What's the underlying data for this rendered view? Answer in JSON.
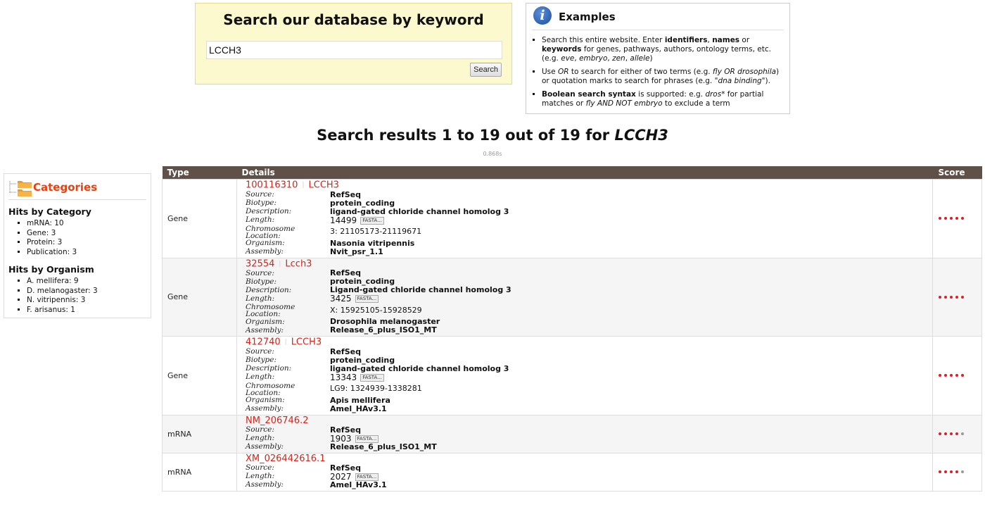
{
  "search": {
    "title": "Search our database by keyword",
    "query": "LCCH3",
    "button_label": "Search"
  },
  "examples": {
    "title": "Examples",
    "items": [
      [
        "Search this entire website. Enter ",
        "identifiers",
        ", ",
        "names",
        " or ",
        "keywords",
        " for genes, pathways, authors, ontology terms, etc. (e.g. ",
        "eve",
        ", ",
        "embryo",
        ", ",
        "zen",
        ", ",
        "allele",
        ")"
      ],
      [
        "Use ",
        "OR",
        " to search for either of two terms (e.g. ",
        "fly OR drosophila",
        ") or quotation marks to search for phrases (e.g. ",
        "\"dna binding\"",
        ")."
      ],
      [
        "Boolean search syntax",
        " is supported: e.g. ",
        "dros*",
        " for partial matches or ",
        "fly AND NOT embryo",
        " to exclude a term"
      ]
    ]
  },
  "results_header": {
    "prefix": "Search results 1 to 19 out of 19 for ",
    "keyword": "LCCH3",
    "timing": "0.868s"
  },
  "categories": {
    "title": "Categories",
    "by_category_heading": "Hits by Category",
    "by_category": [
      "mRNA: 10",
      "Gene: 3",
      "Protein: 3",
      "Publication: 3"
    ],
    "by_organism_heading": "Hits by Organism",
    "by_organism": [
      "A. mellifera: 9",
      "D. melanogaster: 3",
      "N. vitripennis: 3",
      "F. arisanus: 1"
    ]
  },
  "table": {
    "headers": {
      "type": "Type",
      "details": "Details",
      "score": "Score"
    },
    "fasta_label": "FASTA...",
    "rows": [
      {
        "type": "Gene",
        "id": "100116310",
        "symbol": "LCCH3",
        "fields": [
          {
            "label": "Source:",
            "value": "RefSeq"
          },
          {
            "label": "Biotype:",
            "value": "protein_coding"
          },
          {
            "label": "Description:",
            "value": "ligand-gated chloride channel homolog 3"
          },
          {
            "label": "Length:",
            "value": "14499",
            "fasta": true
          },
          {
            "label": "Chromosome Location:",
            "value": "3: 21105173-21119671",
            "plain": true
          },
          {
            "label": "Organism:",
            "value": "Nasonia vitripennis"
          },
          {
            "label": "Assembly:",
            "value": "Nvit_psr_1.1"
          }
        ],
        "score": 5
      },
      {
        "type": "Gene",
        "id": "32554",
        "symbol": "Lcch3",
        "fields": [
          {
            "label": "Source:",
            "value": "RefSeq"
          },
          {
            "label": "Biotype:",
            "value": "protein_coding"
          },
          {
            "label": "Description:",
            "value": "Ligand-gated chloride channel homolog 3"
          },
          {
            "label": "Length:",
            "value": "3425",
            "fasta": true
          },
          {
            "label": "Chromosome Location:",
            "value": "X: 15925105-15928529",
            "plain": true
          },
          {
            "label": "Organism:",
            "value": "Drosophila melanogaster"
          },
          {
            "label": "Assembly:",
            "value": "Release_6_plus_ISO1_MT"
          }
        ],
        "score": 5
      },
      {
        "type": "Gene",
        "id": "412740",
        "symbol": "LCCH3",
        "fields": [
          {
            "label": "Source:",
            "value": "RefSeq"
          },
          {
            "label": "Biotype:",
            "value": "protein_coding"
          },
          {
            "label": "Description:",
            "value": "ligand-gated chloride channel homolog 3"
          },
          {
            "label": "Length:",
            "value": "13343",
            "fasta": true
          },
          {
            "label": "Chromosome Location:",
            "value": "LG9: 1324939-1338281",
            "plain": true
          },
          {
            "label": "Organism:",
            "value": "Apis mellifera"
          },
          {
            "label": "Assembly:",
            "value": "Amel_HAv3.1"
          }
        ],
        "score": 5
      },
      {
        "type": "mRNA",
        "id": "NM_206746.2",
        "symbol": "",
        "fields": [
          {
            "label": "Source:",
            "value": "RefSeq"
          },
          {
            "label": "Length:",
            "value": "1903",
            "fasta": true
          },
          {
            "label": "Assembly:",
            "value": "Release_6_plus_ISO1_MT"
          }
        ],
        "score": 4
      },
      {
        "type": "mRNA",
        "id": "XM_026442616.1",
        "symbol": "",
        "fields": [
          {
            "label": "Source:",
            "value": "RefSeq"
          },
          {
            "label": "Length:",
            "value": "2027",
            "fasta": true
          },
          {
            "label": "Assembly:",
            "value": "Amel_HAv3.1"
          }
        ],
        "score": 4
      }
    ]
  }
}
